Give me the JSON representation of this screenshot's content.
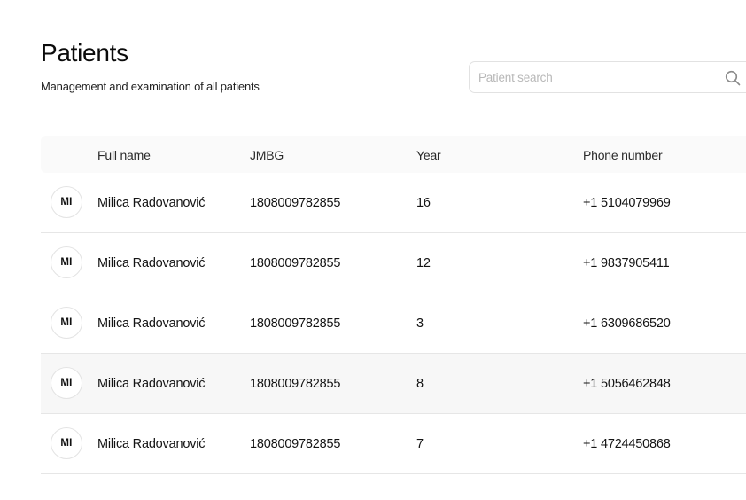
{
  "header": {
    "title": "Patients",
    "subtitle": "Management and examination of all patients"
  },
  "search": {
    "placeholder": "Patient search",
    "value": "",
    "icon": "search-icon"
  },
  "table": {
    "columns": {
      "full_name": "Full name",
      "jmbg": "JMBG",
      "year": "Year",
      "phone": "Phone number"
    },
    "rows": [
      {
        "initials": "MI",
        "full_name": "Milica Radovanović",
        "jmbg": "1808009782855",
        "year": "16",
        "phone": "+1 5104079969"
      },
      {
        "initials": "MI",
        "full_name": "Milica Radovanović",
        "jmbg": "1808009782855",
        "year": "12",
        "phone": "+1 9837905411"
      },
      {
        "initials": "MI",
        "full_name": "Milica Radovanović",
        "jmbg": "1808009782855",
        "year": "3",
        "phone": "+1 6309686520"
      },
      {
        "initials": "MI",
        "full_name": "Milica Radovanović",
        "jmbg": "1808009782855",
        "year": "8",
        "phone": "+1 5056462848"
      },
      {
        "initials": "MI",
        "full_name": "Milica Radovanović",
        "jmbg": "1808009782855",
        "year": "7",
        "phone": "+1 4724450868"
      }
    ]
  },
  "colors": {
    "header_row_bg": "#fafafa",
    "hover_row_bg": "#f7f7f7",
    "divider": "#e6e6e6",
    "placeholder": "#b8b8b8"
  }
}
